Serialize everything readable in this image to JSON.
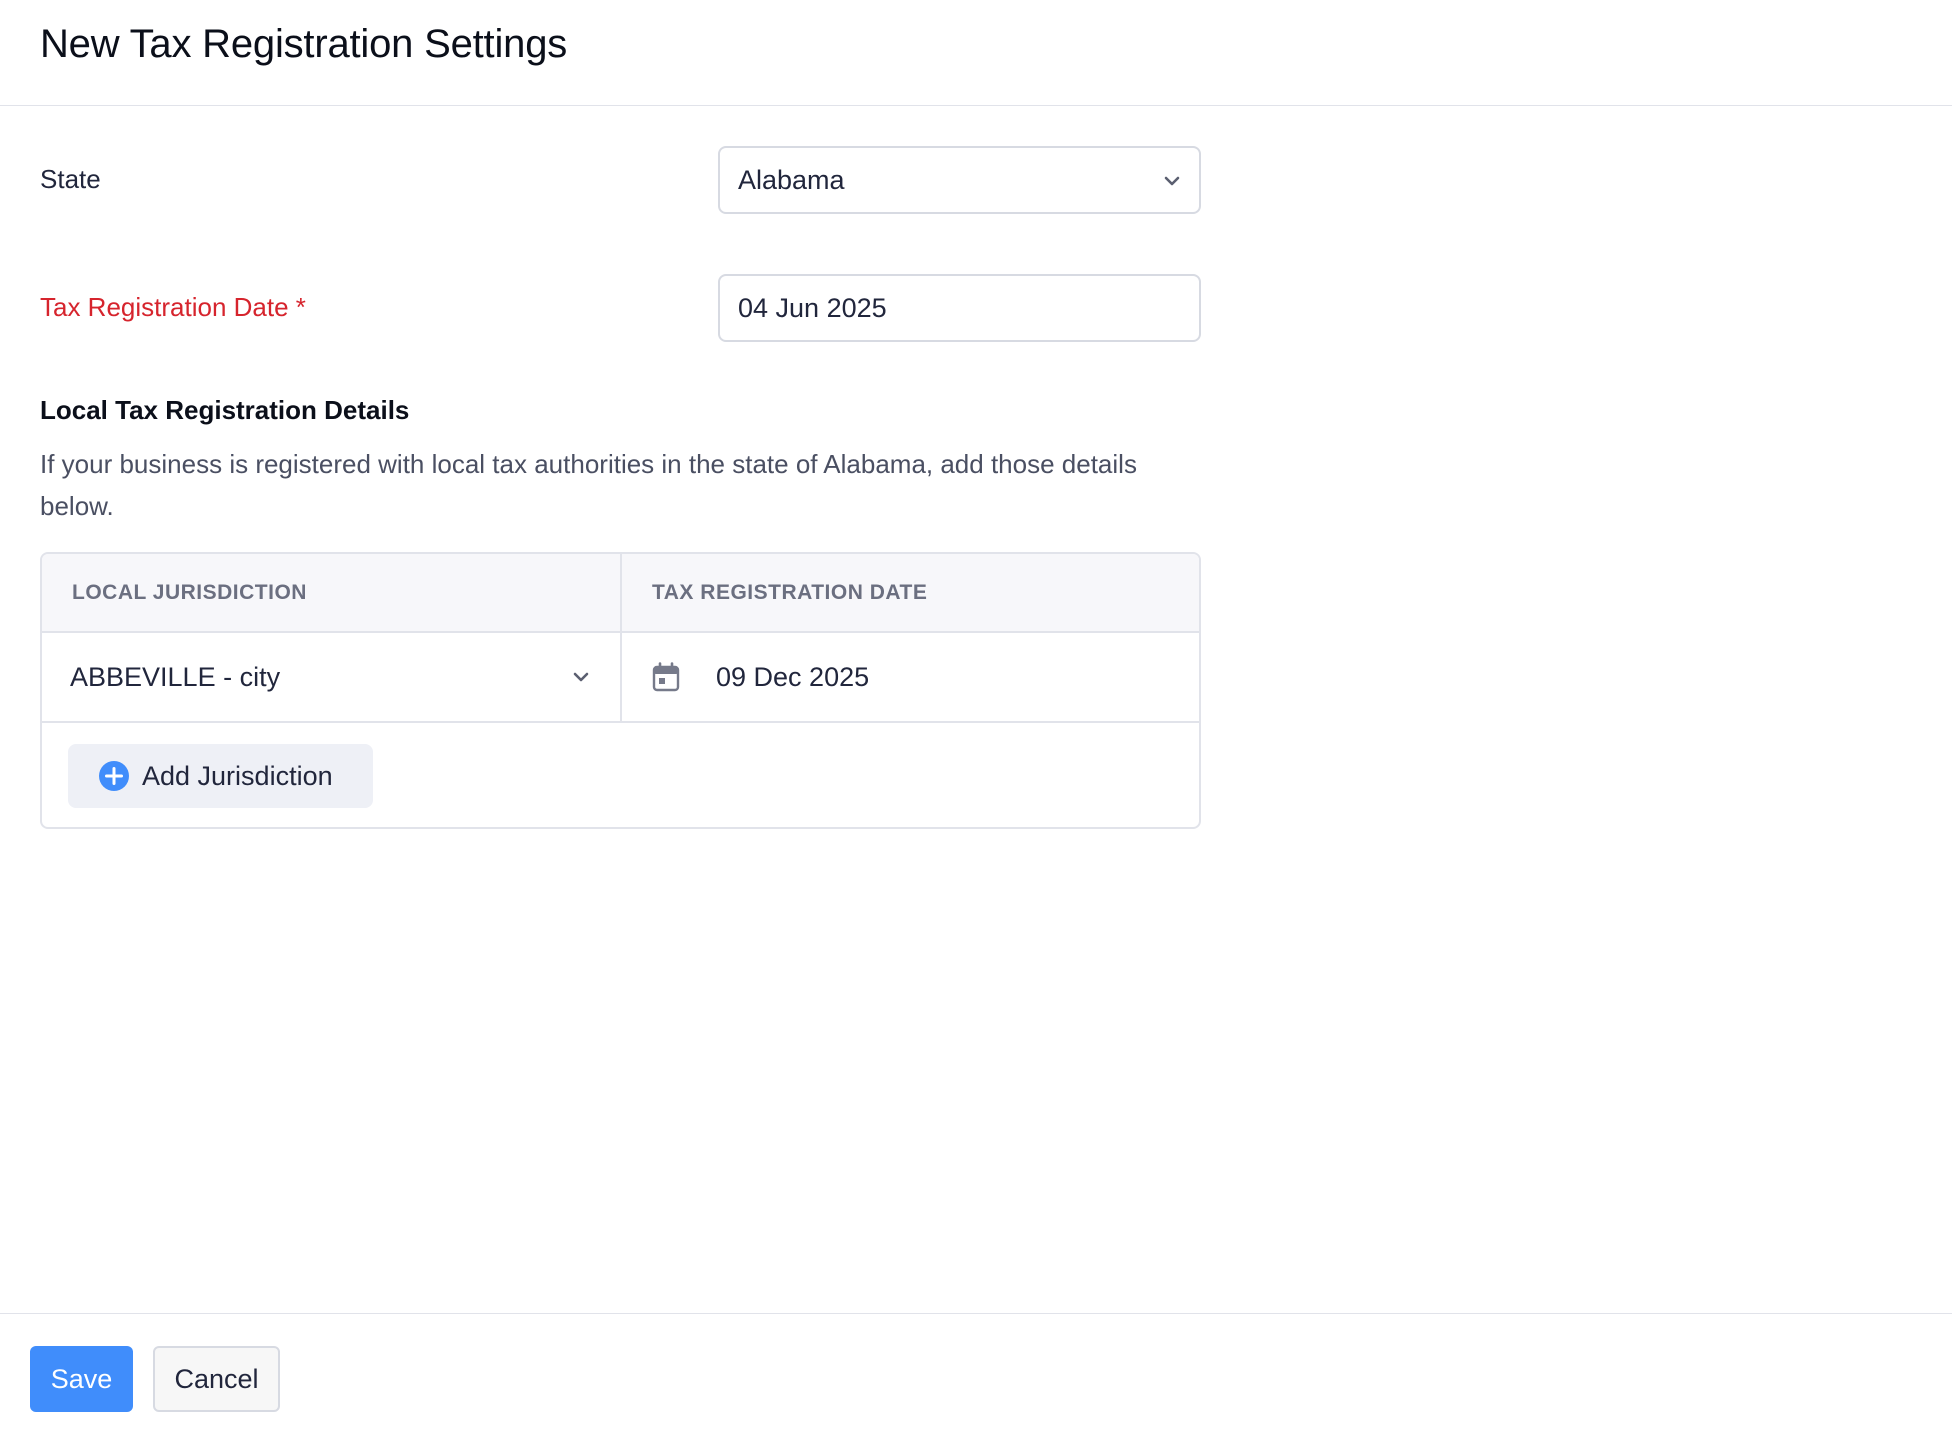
{
  "header": {
    "title": "New Tax Registration Settings"
  },
  "form": {
    "state": {
      "label": "State",
      "value": "Alabama",
      "icon": "chevron-down-icon"
    },
    "tax_registration_date": {
      "label": "Tax Registration Date *",
      "value": "04 Jun 2025",
      "required": true
    }
  },
  "local_section": {
    "title": "Local Tax Registration Details",
    "description": "If your business is registered with local tax authorities in the state of Alabama, add those details below.",
    "columns": [
      "LOCAL JURISDICTION",
      "TAX REGISTRATION DATE"
    ],
    "rows": [
      {
        "jurisdiction": "ABBEVILLE - city",
        "date": "09 Dec 2025"
      }
    ],
    "add_button": {
      "label": "Add Jurisdiction",
      "icon": "plus-circle-icon"
    }
  },
  "footer": {
    "save_label": "Save",
    "cancel_label": "Cancel"
  },
  "colors": {
    "primary": "#408dfb",
    "required": "#d6242d",
    "border": "#e1e3ea",
    "table_header_bg": "#f7f7fa",
    "add_button_bg": "#eef0f6"
  }
}
